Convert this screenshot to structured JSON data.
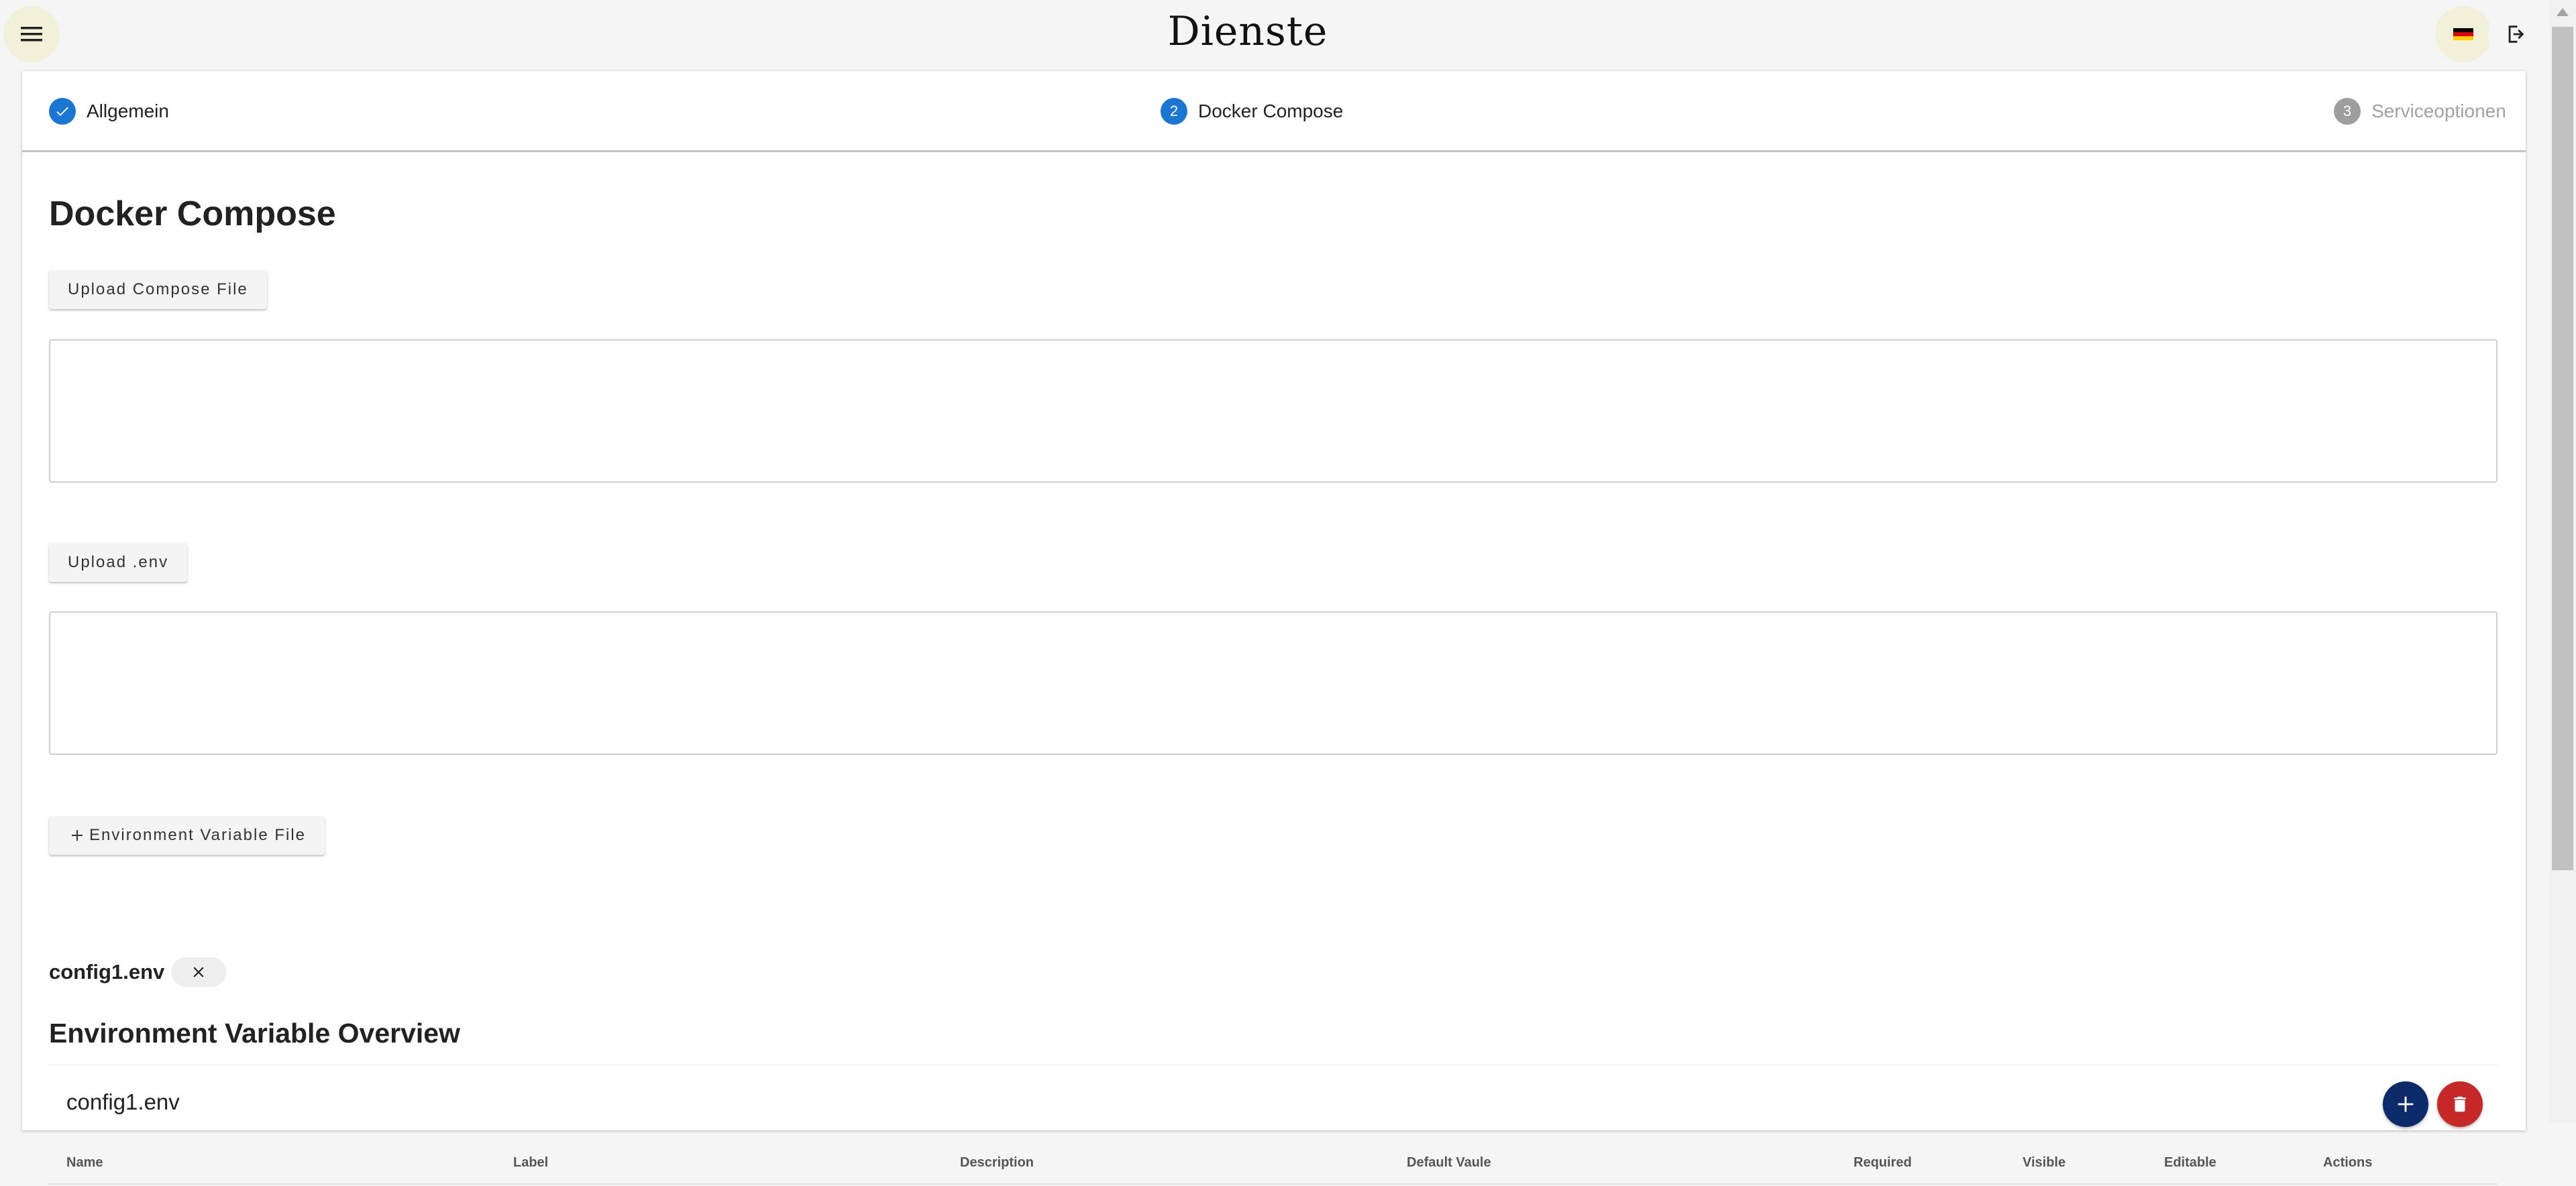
{
  "app": {
    "title": "Dienste"
  },
  "icons": {
    "menu": "menu-icon",
    "language": "german-flag-icon",
    "logout": "logout-icon",
    "check": "check-icon",
    "plus": "plus-icon",
    "close": "close-icon",
    "delete": "trash-icon"
  },
  "colors": {
    "primary": "#1976d2",
    "fab_add": "#0d2a6b",
    "fab_delete": "#c62828"
  },
  "stepper": {
    "steps": [
      {
        "number": "1",
        "label": "Allgemein",
        "state": "done"
      },
      {
        "number": "2",
        "label": "Docker Compose",
        "state": "active"
      },
      {
        "number": "3",
        "label": "Serviceoptionen",
        "state": "todo"
      }
    ]
  },
  "main": {
    "title": "Docker Compose",
    "upload_compose_label": "Upload Compose File",
    "compose_value": "",
    "upload_env_label": "Upload .env",
    "env_value": "",
    "add_env_file_label": "Environment Variable File"
  },
  "env_files": {
    "chips": [
      {
        "label": "config1.env"
      }
    ]
  },
  "overview": {
    "title": "Environment Variable Overview",
    "file_name": "config1.env",
    "columns": [
      "Name",
      "Label",
      "Description",
      "Default Vaule",
      "Required",
      "Visible",
      "Editable",
      "Actions"
    ]
  }
}
